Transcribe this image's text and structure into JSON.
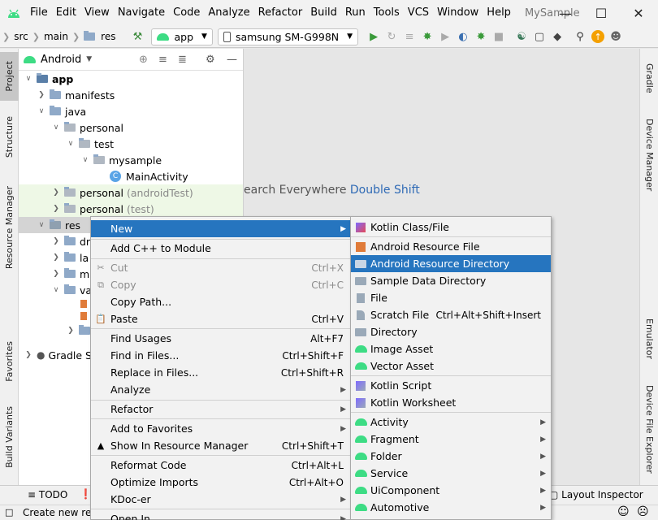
{
  "menubar": {
    "items": [
      "File",
      "Edit",
      "View",
      "Navigate",
      "Code",
      "Analyze",
      "Refactor",
      "Build",
      "Run",
      "Tools",
      "VCS",
      "Window",
      "Help"
    ],
    "app_title": "MySample"
  },
  "toolbar": {
    "breadcrumb": [
      "src",
      "main",
      "res"
    ],
    "run_config": "app",
    "device": "samsung SM-G998N"
  },
  "left_tabs": [
    "Project",
    "Structure",
    "Resource Manager",
    "Favorites",
    "Build Variants"
  ],
  "right_tabs": [
    "Gradle",
    "Device Manager",
    "Emulator",
    "Device File Explorer"
  ],
  "project": {
    "view": "Android",
    "tree": [
      {
        "label": "app",
        "bold": true
      },
      {
        "label": "manifests"
      },
      {
        "label": "java"
      },
      {
        "label": "personal"
      },
      {
        "label": "test"
      },
      {
        "label": "mysample"
      },
      {
        "label": "MainActivity"
      },
      {
        "label": "personal",
        "suffix": "(androidTest)"
      },
      {
        "label": "personal",
        "suffix": "(test)"
      },
      {
        "label": "res"
      },
      {
        "label": "dr"
      },
      {
        "label": "la"
      },
      {
        "label": "m"
      },
      {
        "label": "va"
      },
      {
        "label": "Gradle S"
      }
    ]
  },
  "editor": {
    "hint_text": "earch Everywhere",
    "hint_shortcut": "Double Shift"
  },
  "context_menu": {
    "items": [
      {
        "label": "New",
        "submenu": true,
        "active": true
      },
      {
        "label": "Add C++ to Module"
      },
      {
        "label": "Cut",
        "shortcut": "Ctrl+X",
        "disabled": true
      },
      {
        "label": "Copy",
        "shortcut": "Ctrl+C",
        "disabled": true
      },
      {
        "label": "Copy Path..."
      },
      {
        "label": "Paste",
        "shortcut": "Ctrl+V"
      },
      {
        "label": "Find Usages",
        "shortcut": "Alt+F7"
      },
      {
        "label": "Find in Files...",
        "shortcut": "Ctrl+Shift+F"
      },
      {
        "label": "Replace in Files...",
        "shortcut": "Ctrl+Shift+R"
      },
      {
        "label": "Analyze",
        "submenu": true
      },
      {
        "label": "Refactor",
        "submenu": true
      },
      {
        "label": "Add to Favorites",
        "submenu": true
      },
      {
        "label": "Show In Resource Manager",
        "shortcut": "Ctrl+Shift+T"
      },
      {
        "label": "Reformat Code",
        "shortcut": "Ctrl+Alt+L"
      },
      {
        "label": "Optimize Imports",
        "shortcut": "Ctrl+Alt+O"
      },
      {
        "label": "KDoc-er",
        "submenu": true
      },
      {
        "label": "Open In",
        "submenu": true
      }
    ]
  },
  "new_submenu": {
    "items": [
      {
        "label": "Kotlin Class/File"
      },
      {
        "label": "Android Resource File"
      },
      {
        "label": "Android Resource Directory",
        "active": true
      },
      {
        "label": "Sample Data Directory"
      },
      {
        "label": "File"
      },
      {
        "label": "Scratch File",
        "shortcut": "Ctrl+Alt+Shift+Insert"
      },
      {
        "label": "Directory"
      },
      {
        "label": "Image Asset"
      },
      {
        "label": "Vector Asset"
      },
      {
        "label": "Kotlin Script"
      },
      {
        "label": "Kotlin Worksheet"
      },
      {
        "label": "Activity",
        "submenu": true
      },
      {
        "label": "Fragment",
        "submenu": true
      },
      {
        "label": "Folder",
        "submenu": true
      },
      {
        "label": "Service",
        "submenu": true
      },
      {
        "label": "UiComponent",
        "submenu": true
      },
      {
        "label": "Automotive",
        "submenu": true
      }
    ]
  },
  "bottom_tools": {
    "todo": "TODO",
    "layout_inspector": "Layout Inspector"
  },
  "status": {
    "text": "Create new reso"
  },
  "colors": {
    "selection": "#2675bf",
    "android_green": "#3ddc84"
  }
}
